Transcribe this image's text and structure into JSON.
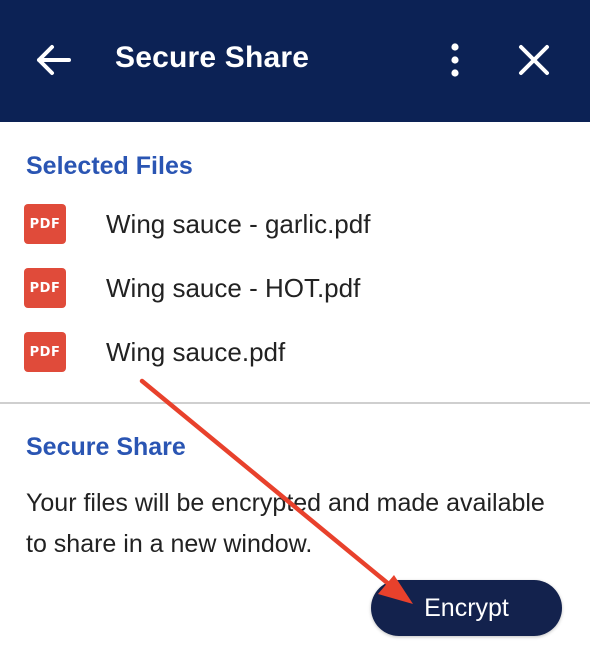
{
  "header": {
    "title": "Secure Share",
    "back_icon": "arrow-left-icon",
    "more_icon": "kebab-menu-icon",
    "close_icon": "close-icon",
    "background_color": "#0c2255"
  },
  "selected_files": {
    "heading": "Selected Files",
    "files": [
      {
        "name": "Wing sauce - garlic.pdf",
        "icon_label": "PDF"
      },
      {
        "name": "Wing sauce - HOT.pdf",
        "icon_label": "PDF"
      },
      {
        "name": "Wing sauce.pdf",
        "icon_label": "PDF"
      }
    ]
  },
  "secure_share": {
    "heading": "Secure Share",
    "description": "Your files will be encrypted and made available to share in a new window."
  },
  "actions": {
    "encrypt_label": "Encrypt"
  },
  "colors": {
    "accent": "#2a55b3",
    "pdf_icon": "#e04b3a",
    "button": "#13224d",
    "annotation_arrow": "#e8412c"
  }
}
